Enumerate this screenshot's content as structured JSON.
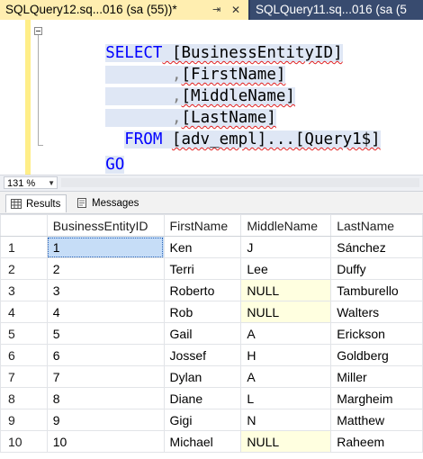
{
  "tabs": [
    {
      "label": "SQLQuery12.sq...016 (sa (55))*",
      "pin_icon": "pin-icon",
      "close_icon": "close-icon"
    },
    {
      "label": "SQLQuery11.sq...016 (sa (5"
    }
  ],
  "editor": {
    "lines": [
      {
        "kw": "SELECT",
        "rest": " [BusinessEntityID]"
      },
      {
        "indent": "       ,",
        "rest": "[FirstName]"
      },
      {
        "indent": "       ,",
        "rest": "[MiddleName]"
      },
      {
        "indent": "       ,",
        "rest": "[LastName]"
      },
      {
        "kw": "FROM",
        "rest": "[adv_empl]...[Query1$]"
      },
      {
        "kw": "GO"
      }
    ]
  },
  "zoom": "131 %",
  "result_tabs": {
    "results": "Results",
    "messages": "Messages"
  },
  "grid": {
    "columns": [
      "BusinessEntityID",
      "FirstName",
      "MiddleName",
      "LastName"
    ],
    "rows": [
      {
        "n": "1",
        "BusinessEntityID": "1",
        "FirstName": "Ken",
        "MiddleName": "J",
        "LastName": "Sánchez"
      },
      {
        "n": "2",
        "BusinessEntityID": "2",
        "FirstName": "Terri",
        "MiddleName": "Lee",
        "LastName": "Duffy"
      },
      {
        "n": "3",
        "BusinessEntityID": "3",
        "FirstName": "Roberto",
        "MiddleName": "NULL",
        "LastName": "Tamburello"
      },
      {
        "n": "4",
        "BusinessEntityID": "4",
        "FirstName": "Rob",
        "MiddleName": "NULL",
        "LastName": "Walters"
      },
      {
        "n": "5",
        "BusinessEntityID": "5",
        "FirstName": "Gail",
        "MiddleName": "A",
        "LastName": "Erickson"
      },
      {
        "n": "6",
        "BusinessEntityID": "6",
        "FirstName": "Jossef",
        "MiddleName": "H",
        "LastName": "Goldberg"
      },
      {
        "n": "7",
        "BusinessEntityID": "7",
        "FirstName": "Dylan",
        "MiddleName": "A",
        "LastName": "Miller"
      },
      {
        "n": "8",
        "BusinessEntityID": "8",
        "FirstName": "Diane",
        "MiddleName": "L",
        "LastName": "Margheim"
      },
      {
        "n": "9",
        "BusinessEntityID": "9",
        "FirstName": "Gigi",
        "MiddleName": "N",
        "LastName": "Matthew"
      },
      {
        "n": "10",
        "BusinessEntityID": "10",
        "FirstName": "Michael",
        "MiddleName": "NULL",
        "LastName": "Raheem"
      }
    ]
  },
  "colors": {
    "active_tab": "#ffeeb0",
    "keyword": "#0000ff",
    "null_cell": "#ffffe0",
    "selected_cell": "#c6ddf7"
  }
}
